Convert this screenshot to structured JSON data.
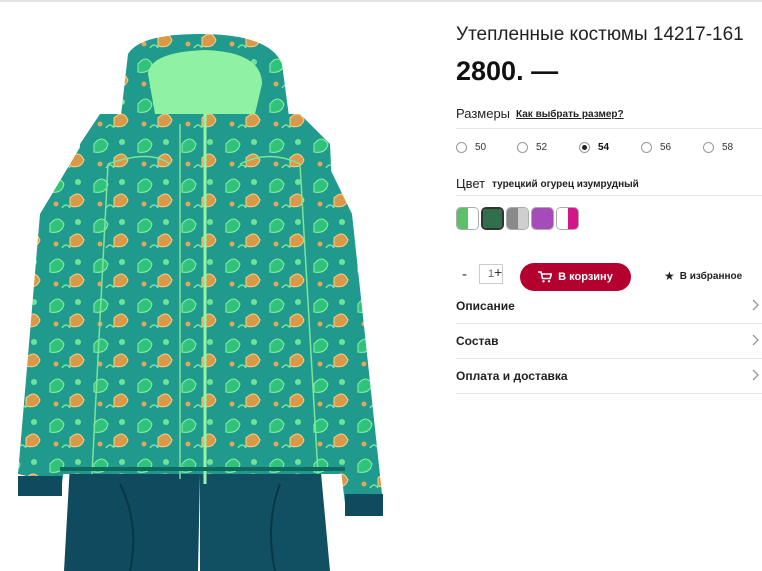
{
  "product": {
    "title": "Утепленные костюмы 14217-161",
    "price": "2800. —"
  },
  "sizes": {
    "label": "Размеры",
    "guide_link": "Как выбрать размер?",
    "options": [
      "50",
      "52",
      "54",
      "56",
      "58"
    ],
    "selected": "54"
  },
  "color": {
    "label": "Цвет",
    "value": "турецкий огурец изумрудный",
    "swatches": [
      {
        "left": "#5cbf6a",
        "right": "#ffffff"
      },
      {
        "left": "#2f6f4a",
        "right": "#2f6f4a"
      },
      {
        "left": "#8a8a8a",
        "right": "#cfcfcf"
      },
      {
        "left": "#a64cb8",
        "right": "#a64cb8"
      },
      {
        "left": "#ffffff",
        "right": "#d4148c"
      }
    ],
    "selected_index": 1
  },
  "quantity": {
    "minus": "-",
    "value": "1",
    "plus": "+"
  },
  "actions": {
    "cart_label": "В корзину",
    "cart_color": "#b3002f",
    "favorite_label": "В избранное"
  },
  "accordion": [
    {
      "label": "Описание"
    },
    {
      "label": "Состав"
    },
    {
      "label": "Оплата и доставка"
    }
  ]
}
